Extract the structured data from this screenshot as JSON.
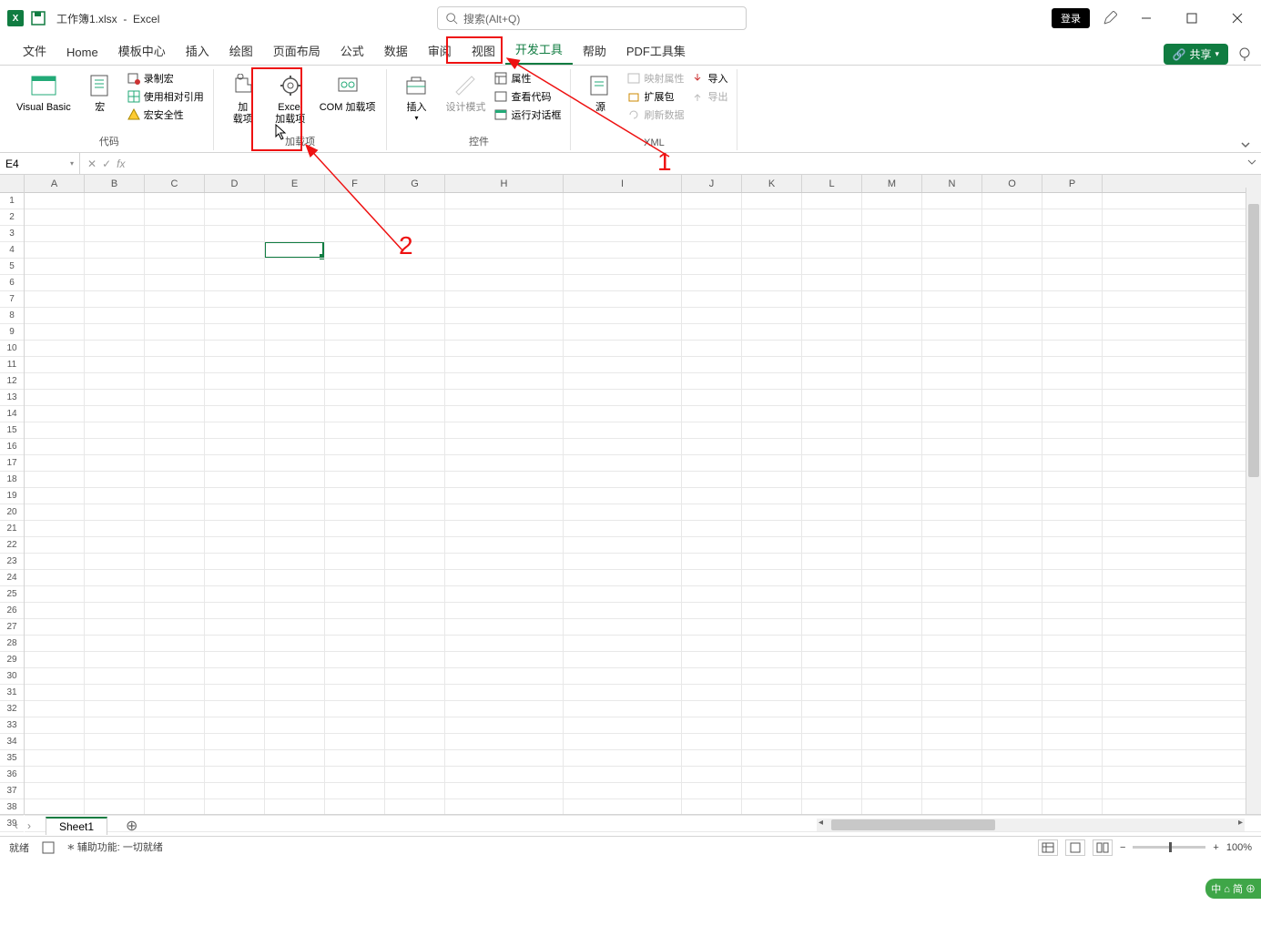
{
  "title": {
    "filename": "工作簿1.xlsx",
    "appname": "Excel"
  },
  "search": {
    "placeholder": "搜索(Alt+Q)"
  },
  "login": "登录",
  "tabs": [
    "文件",
    "Home",
    "模板中心",
    "插入",
    "绘图",
    "页面布局",
    "公式",
    "数据",
    "审阅",
    "视图",
    "开发工具",
    "帮助",
    "PDF工具集"
  ],
  "active_tab": "开发工具",
  "share": "共享",
  "ribbon": {
    "code_group": {
      "label": "代码",
      "vb": "Visual Basic",
      "macro": "宏",
      "record": "录制宏",
      "relref": "使用相对引用",
      "security": "宏安全性"
    },
    "addins_group": {
      "label": "加载项",
      "addins": "加\n载项",
      "excel_addins": "Excel\n加载项",
      "com_addins": "COM 加载项"
    },
    "controls_group": {
      "label": "控件",
      "insert": "插入",
      "design": "设计模式",
      "properties": "属性",
      "viewcode": "查看代码",
      "rundialog": "运行对话框"
    },
    "xml_group": {
      "label": "XML",
      "source": "源",
      "map_props": "映射属性",
      "expansion": "扩展包",
      "refresh": "刷新数据",
      "import": "导入",
      "export": "导出"
    }
  },
  "namebox": "E4",
  "columns": [
    "A",
    "B",
    "C",
    "D",
    "E",
    "F",
    "G",
    "H",
    "I",
    "J",
    "K",
    "L",
    "M",
    "N",
    "O",
    "P"
  ],
  "row_count": 39,
  "selected": {
    "col": "E",
    "row": 4
  },
  "sheet": {
    "name": "Sheet1"
  },
  "status": {
    "ready": "就绪",
    "acc": "辅助功能: 一切就绪",
    "zoom": "100%"
  },
  "annotations": {
    "label1": "1",
    "label2": "2"
  },
  "ime": "中 ⌂ 简 ⊕"
}
